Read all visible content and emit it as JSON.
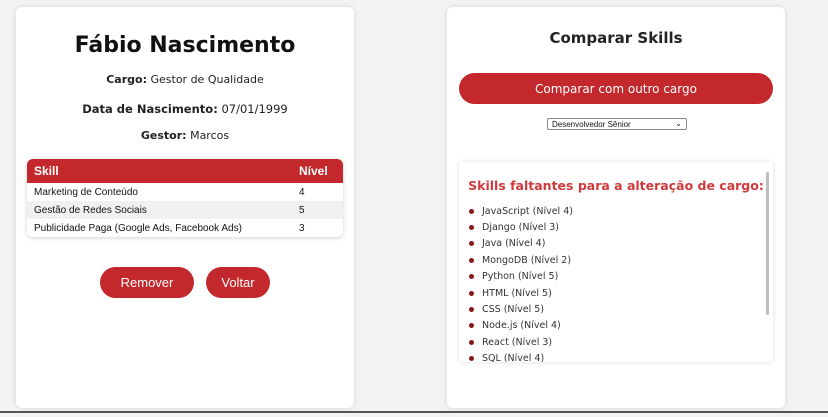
{
  "profile": {
    "name": "Fábio Nascimento",
    "cargo_label": "Cargo:",
    "cargo_value": "Gestor de Qualidade",
    "birth_label": "Data de Nascimento:",
    "birth_value": "07/01/1999",
    "manager_label": "Gestor:",
    "manager_value": "Marcos"
  },
  "skills_table": {
    "headers": [
      "Skill",
      "Nível"
    ],
    "rows": [
      {
        "skill": "Marketing de Conteúdo",
        "level": "4"
      },
      {
        "skill": "Gestão de Redes Sociais",
        "level": "5"
      },
      {
        "skill": "Publicidade Paga (Google Ads, Facebook Ads)",
        "level": "3"
      }
    ]
  },
  "actions": {
    "remove_label": "Remover",
    "back_label": "Voltar"
  },
  "compare": {
    "title": "Comparar Skills",
    "button_label": "Comparar com outro cargo",
    "selected_role": "Desenvolvedor Sênior",
    "missing_title": "Skills faltantes para a alteração de cargo:",
    "missing_skills": [
      "JavaScript (Nível 4)",
      "Django (Nível 3)",
      "Java (Nível 4)",
      "MongoDB (Nível 2)",
      "Python (Nível 5)",
      "HTML (Nível 5)",
      "CSS (Nível 5)",
      "Node.js (Nível 4)",
      "React (Nível 3)",
      "SQL (Nível 4)"
    ]
  },
  "colors": {
    "accent": "#c2282c",
    "missing_title": "#d03a3c",
    "bullet": "#8a1418"
  }
}
